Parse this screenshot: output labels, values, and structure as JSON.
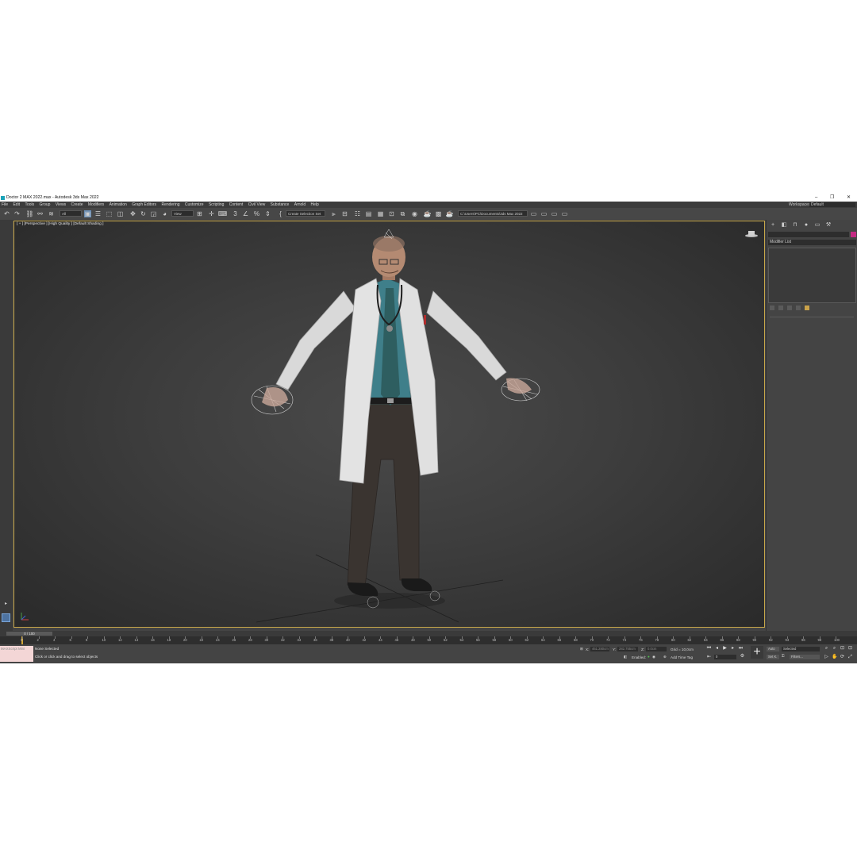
{
  "window": {
    "title": "Doctor 2 MAX 2022.max - Autodesk 3ds Max 2022",
    "controls": [
      "–",
      "❐",
      "✕"
    ]
  },
  "menu": {
    "items": [
      "File",
      "Edit",
      "Tools",
      "Group",
      "Views",
      "Create",
      "Modifiers",
      "Animation",
      "Graph Editors",
      "Rendering",
      "Customize",
      "Scripting",
      "Content",
      "Civil View",
      "Substance",
      "Arnold",
      "Help"
    ],
    "workspace_label": "Workspaces:",
    "workspace_value": "Default"
  },
  "toolbar": {
    "selection_filter": "All",
    "ref_coord": "View",
    "named_selection": "Create Selection Set",
    "project_path": "C:\\Users\\PC\\Documents\\3ds Max 2022",
    "snap_label": "3",
    "percent_icon": "%"
  },
  "viewport": {
    "label": "[ + ] [Perspective ] [High Quality ] [Default Shading ]",
    "figure": "doctor-character-model"
  },
  "command_panel": {
    "modifier_list": "Modifier List",
    "color_swatch": "#c42a83"
  },
  "timeline": {
    "frame_display": "0 / 100",
    "ticks": [
      "0",
      "2",
      "4",
      "6",
      "8",
      "10",
      "12",
      "14",
      "16",
      "18",
      "20",
      "22",
      "24",
      "26",
      "28",
      "30",
      "32",
      "34",
      "36",
      "38",
      "40",
      "42",
      "44",
      "46",
      "48",
      "50",
      "52",
      "54",
      "56",
      "58",
      "60",
      "62",
      "64",
      "66",
      "68",
      "70",
      "72",
      "74",
      "76",
      "78",
      "80",
      "82",
      "84",
      "86",
      "88",
      "90",
      "92",
      "94",
      "96",
      "98",
      "100"
    ]
  },
  "status": {
    "maxscript": "MAXScript Mini",
    "selection": "None Selected",
    "prompt": "Click or click and drag to select objects",
    "x_label": "X:",
    "x_value": "461.280cm",
    "y_label": "Y:",
    "y_value": "282.755cm",
    "z_label": "Z:",
    "z_value": "0.0cm",
    "grid": "Grid = 10,0cm",
    "enabled": "Enabled:",
    "add_time_tag": "Add Time Tag",
    "auto": "Auto",
    "set_k": "Set K.",
    "selected": "Selected",
    "filters": "Filters...",
    "frame_spinner": "0"
  }
}
